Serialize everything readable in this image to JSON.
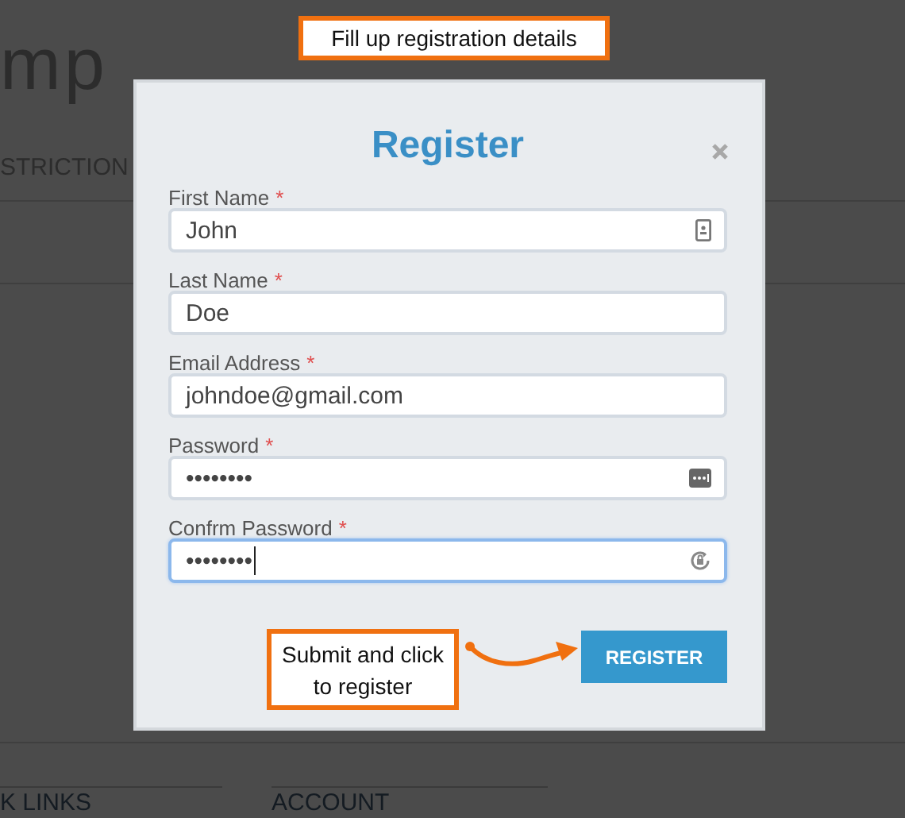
{
  "annotations": [
    {
      "text": "Fill up registration details"
    },
    {
      "text": "Submit and click to register"
    }
  ],
  "background": {
    "brand": "mp",
    "nav_item": "STRICTION",
    "footer_headings": [
      "K LINKS",
      "ACCOUNT"
    ]
  },
  "modal": {
    "title": "Register",
    "fields": [
      {
        "label": "First Name",
        "required_mark": "*",
        "value": "John",
        "focused": false
      },
      {
        "label": "Last Name",
        "required_mark": "*",
        "value": "Doe",
        "focused": false
      },
      {
        "label": "Email Address",
        "required_mark": "*",
        "value": "johndoe@gmail.com",
        "focused": false
      },
      {
        "label": "Password",
        "required_mark": "*",
        "value": "••••••••",
        "focused": false
      },
      {
        "label": "Confrm Password",
        "required_mark": "*",
        "value": "••••••••",
        "focused": true
      }
    ],
    "submit": "REGISTER"
  }
}
